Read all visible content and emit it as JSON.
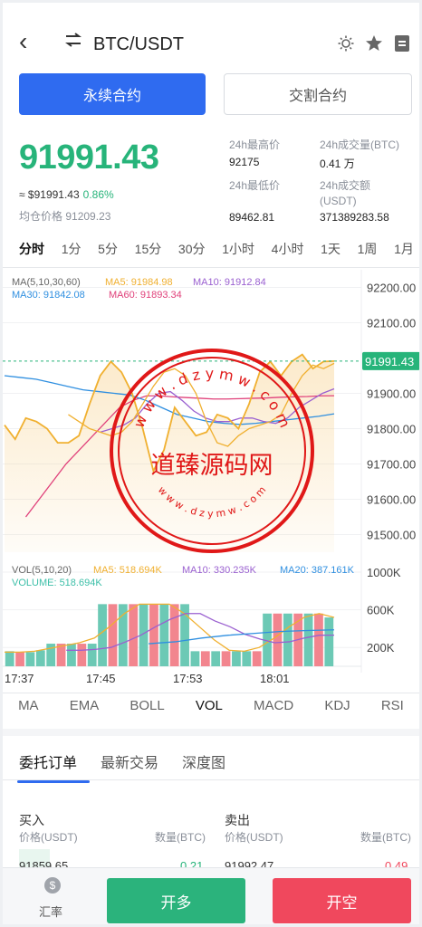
{
  "header": {
    "pair": "BTC/USDT"
  },
  "contract_tabs": [
    "永续合约",
    "交割合约"
  ],
  "ticker": {
    "price": "91991.43",
    "approx": "≈ $91991.43",
    "change_pct": "0.86%",
    "avg_label": "均仓价格",
    "avg_value": "91209.23",
    "high_label": "24h最高价",
    "high_value": "92175",
    "low_label": "24h最低价",
    "low_value": "89462.81",
    "vol_label": "24h成交量(BTC)",
    "vol_value": "0.41 万",
    "amount_label_1": "24h成交额",
    "amount_label_2": "(USDT)",
    "amount_value": "371389283.58"
  },
  "periods": [
    "分时",
    "1分",
    "5分",
    "15分",
    "30分",
    "1小时",
    "4小时",
    "1天",
    "1周",
    "1月"
  ],
  "chart_legend": {
    "ma_title": "MA(5,10,30,60)",
    "ma5": "MA5: 91984.98",
    "ma10": "MA10: 91912.84",
    "ma30": "MA30: 91842.08",
    "ma60": "MA60: 91893.34",
    "vol_title": "VOL(5,10,20)",
    "vol_ma5": "MA5: 518.694K",
    "vol_ma10": "MA10: 330.235K",
    "vol_ma20": "MA20: 387.161K",
    "volume": "VOLUME: 518.694K"
  },
  "current_price_tag": "91991.43",
  "y_axis_labels": [
    "92200.00",
    "92100.00",
    "91900.00",
    "91800.00",
    "91700.00",
    "91600.00",
    "91500.00"
  ],
  "vol_axis_labels": [
    "1000K",
    "600K",
    "200K"
  ],
  "time_labels": [
    "17:37",
    "17:45",
    "17:53",
    "18:01"
  ],
  "indicators": [
    "MA",
    "EMA",
    "BOLL",
    "VOL",
    "MACD",
    "KDJ",
    "RSI"
  ],
  "order_tabs": [
    "委托订单",
    "最新交易",
    "深度图"
  ],
  "order_book": {
    "buy_title": "买入",
    "sell_title": "卖出",
    "price_col": "价格(USDT)",
    "qty_col": "数量(BTC)",
    "buy_price": "91859.65",
    "buy_qty": "0.21",
    "sell_price": "91992.47",
    "sell_qty": "0.49"
  },
  "bottom": {
    "rate_label": "汇率",
    "long_label": "开多",
    "short_label": "开空"
  },
  "watermark": {
    "name": "道臻源码网",
    "url_top": "w w w . d z y m w . c o m"
  },
  "colors": {
    "up": "#27b47a",
    "down": "#f0485d",
    "accent": "#2f6bf0",
    "ma5": "#f0b030",
    "ma10": "#9a60d0",
    "ma30": "#2f8fe0",
    "ma60": "#e0407a"
  },
  "chart_data": [
    {
      "type": "line",
      "title": "",
      "x": [
        "17:37",
        "17:45",
        "17:53",
        "18:01"
      ],
      "ylim": [
        91450,
        92250
      ],
      "series": [
        {
          "name": "MA5",
          "last": 91984.98
        },
        {
          "name": "MA10",
          "last": 91912.84
        },
        {
          "name": "MA30",
          "last": 91842.08
        },
        {
          "name": "MA60",
          "last": 91893.34
        }
      ],
      "price_line": [
        91810,
        91770,
        91830,
        91820,
        91800,
        91760,
        91760,
        91780,
        91870,
        91950,
        91990,
        91960,
        91900,
        91800,
        91680,
        91740,
        91860,
        91820,
        91780,
        91790,
        91840,
        91830,
        91800,
        91870,
        91960,
        91990,
        91950,
        91990,
        92010,
        91970,
        91990,
        91991.43
      ]
    },
    {
      "type": "bar",
      "title": "",
      "ylim": [
        0,
        1000000
      ],
      "series": [
        {
          "name": "VOLUME",
          "values": [
            160000,
            150000,
            150000,
            170000,
            240000,
            240000,
            240000,
            240000,
            240000,
            660000,
            660000,
            660000,
            660000,
            660000,
            660000,
            660000,
            660000,
            660000,
            160000,
            160000,
            160000,
            160000,
            160000,
            160000,
            160000,
            560000,
            560000,
            560000,
            560000,
            560000,
            560000,
            518694
          ]
        }
      ],
      "series_ma": [
        {
          "name": "MA5",
          "last": 518694
        },
        {
          "name": "MA10",
          "last": 330235
        },
        {
          "name": "MA20",
          "last": 387161
        }
      ]
    }
  ]
}
